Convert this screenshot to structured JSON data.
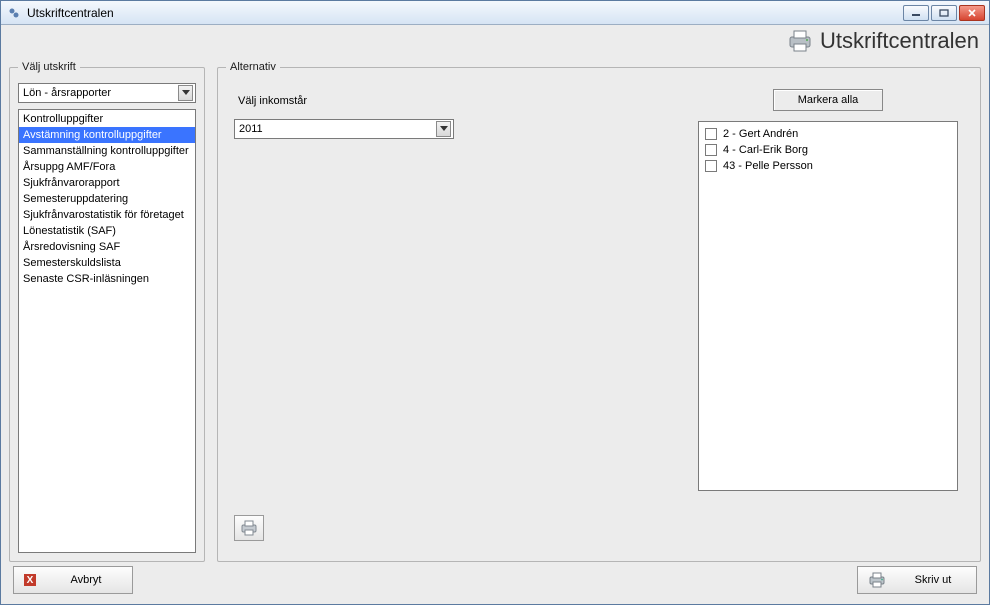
{
  "window": {
    "title": "Utskriftcentralen"
  },
  "header": {
    "title": "Utskriftcentralen"
  },
  "left": {
    "legend": "Välj utskrift",
    "dropdown_value": "Lön - årsrapporter",
    "reports": [
      {
        "label": "Kontrolluppgifter",
        "selected": false
      },
      {
        "label": "Avstämning kontrolluppgifter",
        "selected": true
      },
      {
        "label": "Sammanställning kontrolluppgifter",
        "selected": false
      },
      {
        "label": "Årsuppg AMF/Fora",
        "selected": false
      },
      {
        "label": "Sjukfrånvarorapport",
        "selected": false
      },
      {
        "label": "Semesteruppdatering",
        "selected": false
      },
      {
        "label": "Sjukfrånvarostatistik för företaget",
        "selected": false
      },
      {
        "label": "Lönestatistik (SAF)",
        "selected": false
      },
      {
        "label": "Årsredovisning SAF",
        "selected": false
      },
      {
        "label": "Semesterskuldslista",
        "selected": false
      },
      {
        "label": "Senaste CSR-inläsningen",
        "selected": false
      }
    ]
  },
  "alternativ": {
    "legend": "Alternativ",
    "year_label": "Välj inkomstår",
    "year_value": "2011",
    "select_all_label": "Markera alla",
    "people": [
      {
        "label": "2 - Gert Andrén",
        "checked": false
      },
      {
        "label": "4 - Carl-Erik Borg",
        "checked": false
      },
      {
        "label": "43 - Pelle Persson",
        "checked": false
      }
    ]
  },
  "footer": {
    "cancel_label": "Avbryt",
    "print_label": "Skriv ut"
  }
}
